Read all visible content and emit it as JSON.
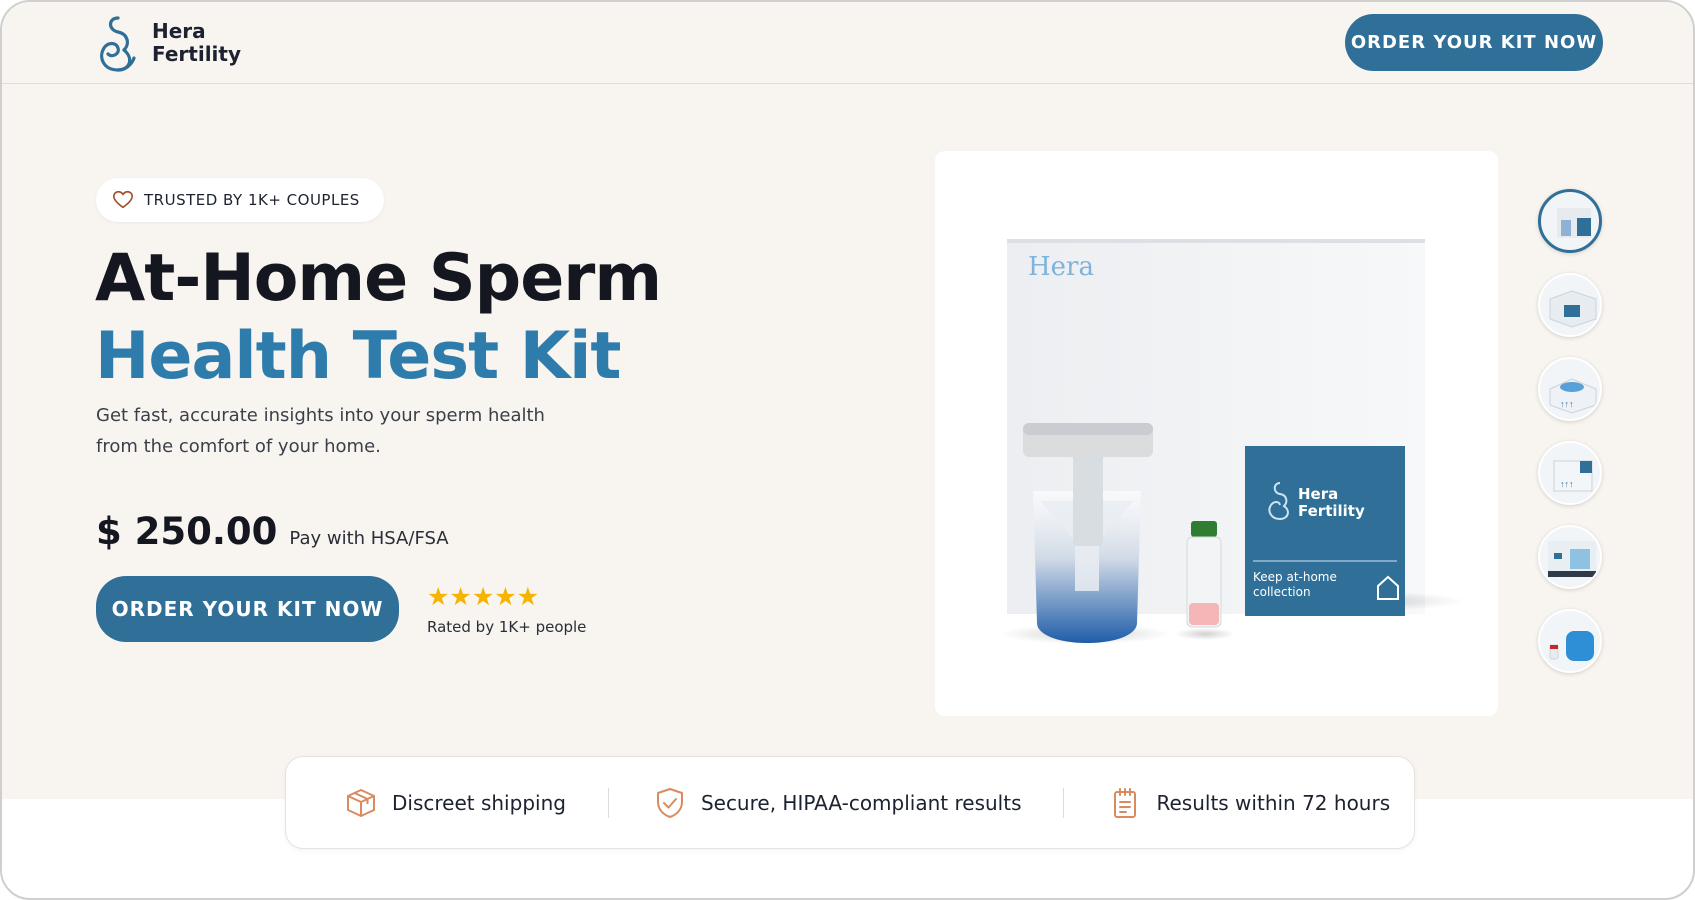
{
  "brand": {
    "line1": "Hera",
    "line2": "Fertility"
  },
  "header": {
    "cta_label": "ORDER YOUR KIT NOW"
  },
  "hero": {
    "badge": "TRUSTED BY 1K+ COUPLES",
    "title_line1": "At-Home Sperm",
    "title_line2": "Health Test Kit",
    "subtitle": "Get fast, accurate insights into your sperm health from the comfort of your home.",
    "price": "$ 250.00",
    "price_note": "Pay with HSA/FSA",
    "cta_label": "ORDER YOUR KIT NOW",
    "stars": "★★★★★",
    "rating_label": "Rated by 1K+ people"
  },
  "product_box": {
    "wordmark": "Hera",
    "label_line1": "Hera",
    "label_line2": "Fertility",
    "tag_line1": "Keep at-home",
    "tag_line2": "collection"
  },
  "features": [
    {
      "label": "Discreet shipping",
      "icon": "box-icon"
    },
    {
      "label": "Secure, HIPAA-compliant results",
      "icon": "shield-check-icon"
    },
    {
      "label": "Results within 72 hours",
      "icon": "clipboard-icon"
    }
  ],
  "colors": {
    "primary": "#2f6f98",
    "title_accent": "#2e7cab",
    "hero_bg": "#f8f4f0",
    "star": "#f4b400",
    "feature_icon": "#d98b5f"
  }
}
